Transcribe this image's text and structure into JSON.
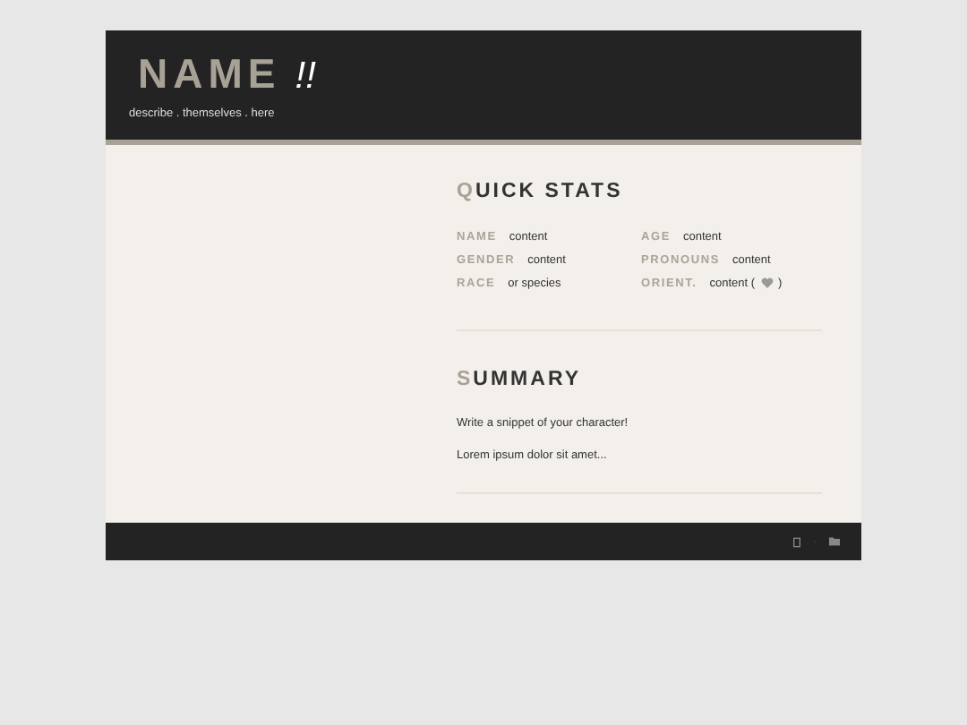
{
  "header": {
    "title": "NAME",
    "title_mark": "!!",
    "subtitle": "describe . themselves . here"
  },
  "quick_stats": {
    "heading": "QUICK STATS",
    "stats": [
      {
        "label": "NAME",
        "value": "content"
      },
      {
        "label": "AGE",
        "value": "content"
      },
      {
        "label": "GENDER",
        "value": "content"
      },
      {
        "label": "PRONOUNS",
        "value": "content"
      },
      {
        "label": "RACE",
        "value": "or species"
      },
      {
        "label": "ORIENT.",
        "value": "content (",
        "kind": "with_icon",
        "value_after": ")"
      }
    ]
  },
  "summary": {
    "heading": "SUMMARY",
    "paragraphs": [
      "Write a snippet of your character!",
      "Lorem ipsum dolor sit amet..."
    ]
  },
  "footer": {
    "separator": "·"
  }
}
